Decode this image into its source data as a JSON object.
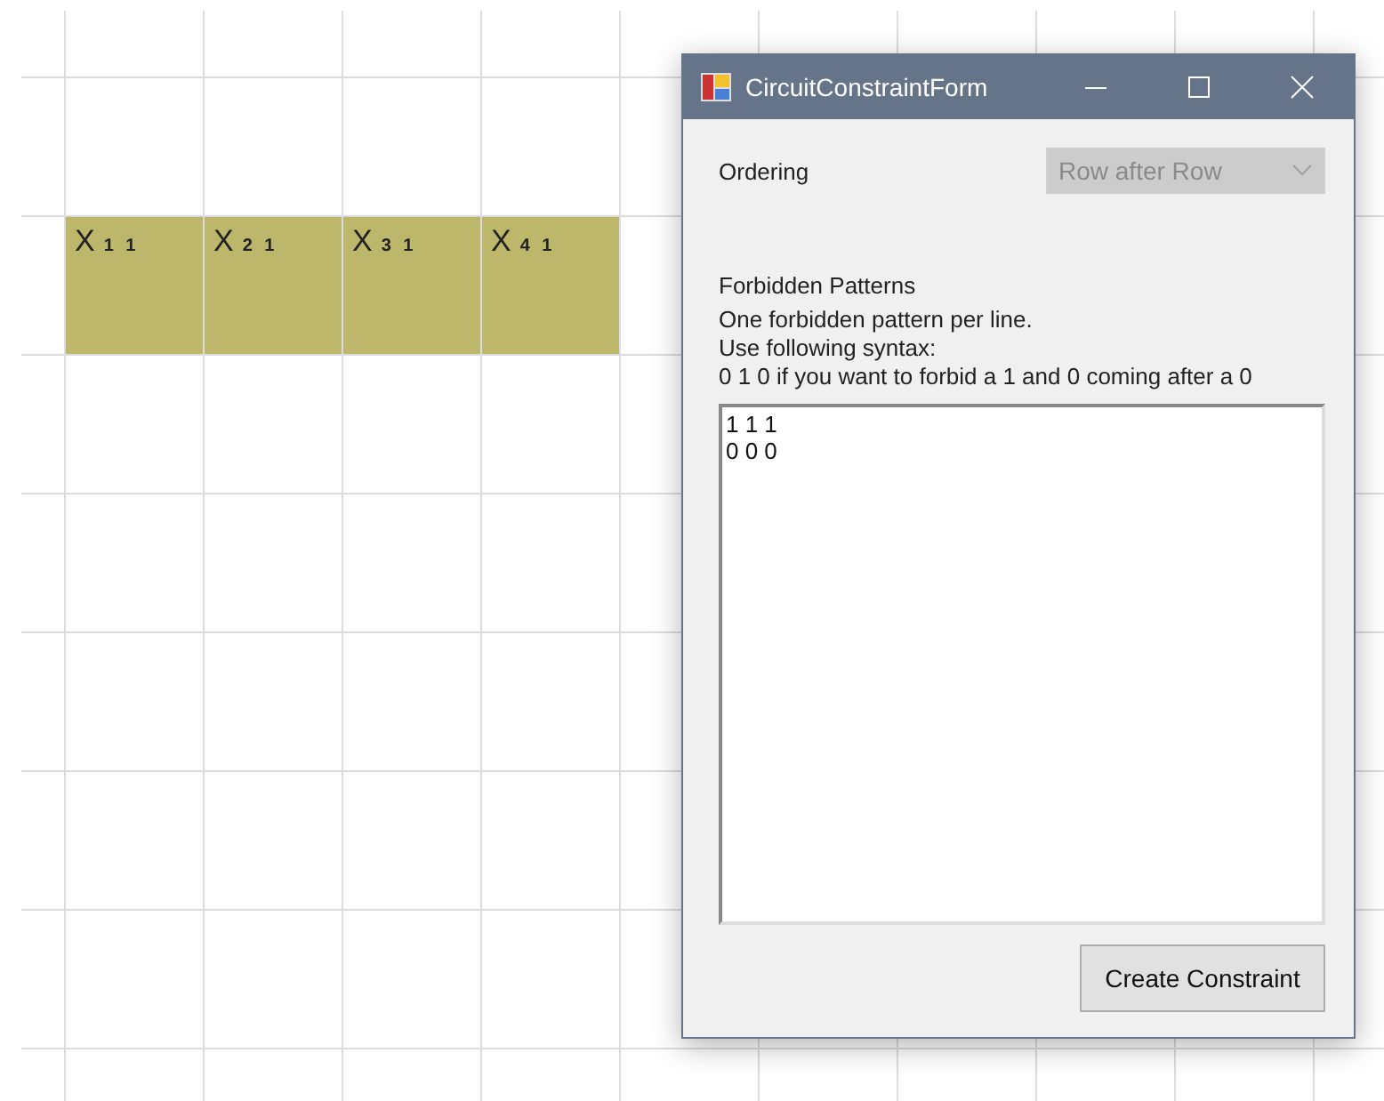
{
  "grid": {
    "cells": [
      {
        "label": "X",
        "index": "1 1"
      },
      {
        "label": "X",
        "index": "2 1"
      },
      {
        "label": "X",
        "index": "3 1"
      },
      {
        "label": "X",
        "index": "4 1"
      }
    ]
  },
  "window": {
    "title": "CircuitConstraintForm",
    "ordering": {
      "label": "Ordering",
      "value": "Row after Row",
      "disabled": true
    },
    "patterns": {
      "heading": "Forbidden Patterns",
      "help": [
        "One forbidden pattern per line.",
        "Use following syntax:",
        "0 1 0 if you want to forbid a 1 and 0 coming after a 0"
      ],
      "value": "1 1 1\n0 0 0\n"
    },
    "button": "Create Constraint"
  }
}
